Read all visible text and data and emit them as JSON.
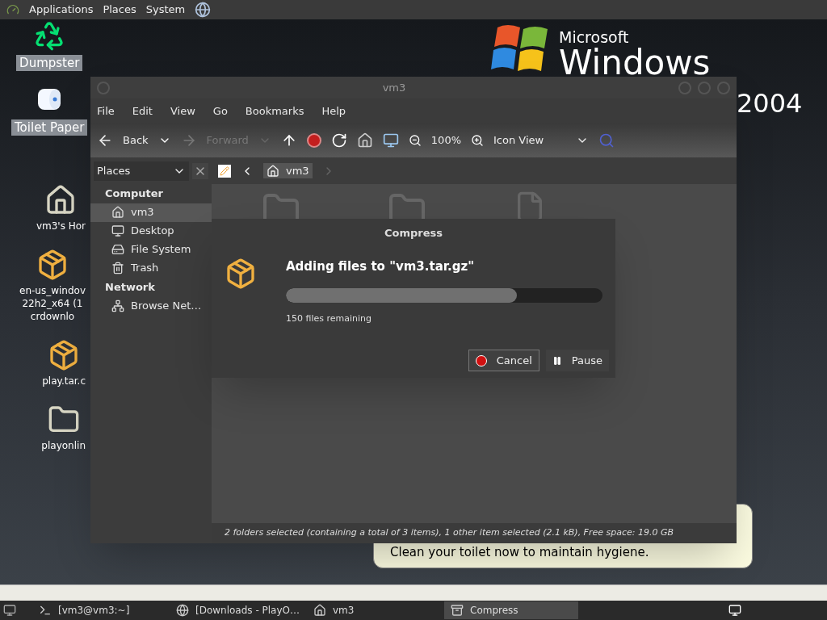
{
  "top_panel": {
    "menus": [
      "Applications",
      "Places",
      "System"
    ]
  },
  "wallpaper": {
    "brand": "Microsoft",
    "product": "Windows",
    "year": "2004"
  },
  "desktop_icons": [
    {
      "kind": "recycle",
      "lines": [
        "Dumpster"
      ],
      "selected": true
    },
    {
      "kind": "roll",
      "lines": [
        "Toilet Paper"
      ],
      "selected": true
    },
    {
      "kind": "home",
      "lines": [
        "vm3's Hor"
      ],
      "selected": false
    },
    {
      "kind": "package",
      "lines": [
        "en-us_windov",
        "22h2_x64 (1",
        "crdownlo"
      ],
      "selected": false
    },
    {
      "kind": "package",
      "lines": [
        "play.tar.c"
      ],
      "selected": false
    },
    {
      "kind": "folder",
      "lines": [
        "playonlin"
      ],
      "selected": false
    }
  ],
  "window": {
    "title": "vm3",
    "menu": [
      "File",
      "Edit",
      "View",
      "Go",
      "Bookmarks",
      "Help"
    ],
    "toolbar": {
      "back": {
        "label": "Back",
        "disabled": false
      },
      "forward": {
        "label": "Forward",
        "disabled": true
      },
      "zoom": "100%",
      "view": "Icon View"
    },
    "sidebar": {
      "header": "Places",
      "sections": [
        {
          "title": "Computer",
          "items": [
            {
              "kind": "home",
              "label": "vm3",
              "selected": true
            },
            {
              "kind": "desktop",
              "label": "Desktop",
              "selected": false
            },
            {
              "kind": "drive",
              "label": "File System",
              "selected": false
            },
            {
              "kind": "trash",
              "label": "Trash",
              "selected": false
            }
          ]
        },
        {
          "title": "Network",
          "items": [
            {
              "kind": "network",
              "label": "Browse Net…",
              "selected": false
            }
          ]
        }
      ]
    },
    "path": [
      "vm3"
    ],
    "files": [
      {
        "kind": "folder"
      },
      {
        "kind": "folder"
      },
      {
        "kind": "file"
      }
    ],
    "status_bar": "2 folders selected (containing a total of 3 items), 1 other item selected (2.1 kB), Free space: 19.0 GB"
  },
  "dialog": {
    "title": "Compress",
    "heading": "Adding files to \"vm3.tar.gz\"",
    "level": 0.73,
    "remaining": "150 files remaining",
    "buttons": [
      {
        "kind": "cancel",
        "label": "Cancel"
      },
      {
        "kind": "pause",
        "label": "Pause"
      }
    ]
  },
  "balloon": {
    "text": "Clean your toilet now to maintain hygiene."
  },
  "taskbar": [
    {
      "kind": "terminal",
      "label": "[vm3@vm3:~]",
      "selected": false
    },
    {
      "kind": "browser",
      "label": "[Downloads - PlayO…",
      "selected": false
    },
    {
      "kind": "home",
      "label": "vm3",
      "selected": false
    },
    {
      "kind": "archive",
      "label": "Compress",
      "selected": true
    }
  ]
}
